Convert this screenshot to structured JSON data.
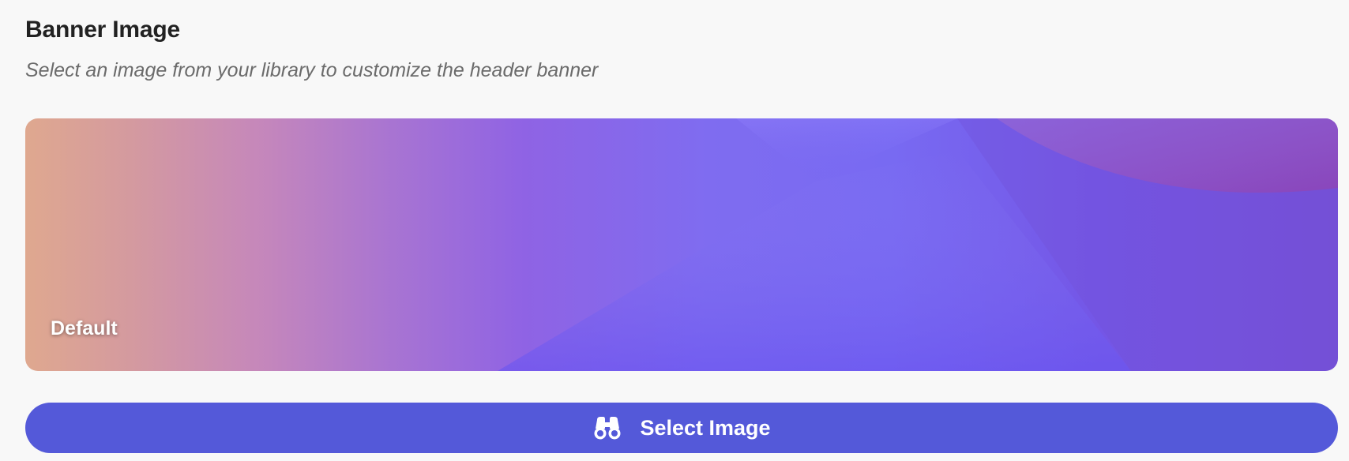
{
  "banner_section": {
    "title": "Banner Image",
    "subtitle": "Select an image from your library to customize the header banner",
    "preview_label": "Default",
    "select_button_label": "Select Image",
    "button_icon": "binoculars-icon"
  },
  "colors": {
    "page_background": "#f8f8f8",
    "button_accent": "#5459d9",
    "banner_gradient": [
      "#dfa88f",
      "#c587bb",
      "#8f63e4",
      "#786af2",
      "#7650d6"
    ]
  }
}
